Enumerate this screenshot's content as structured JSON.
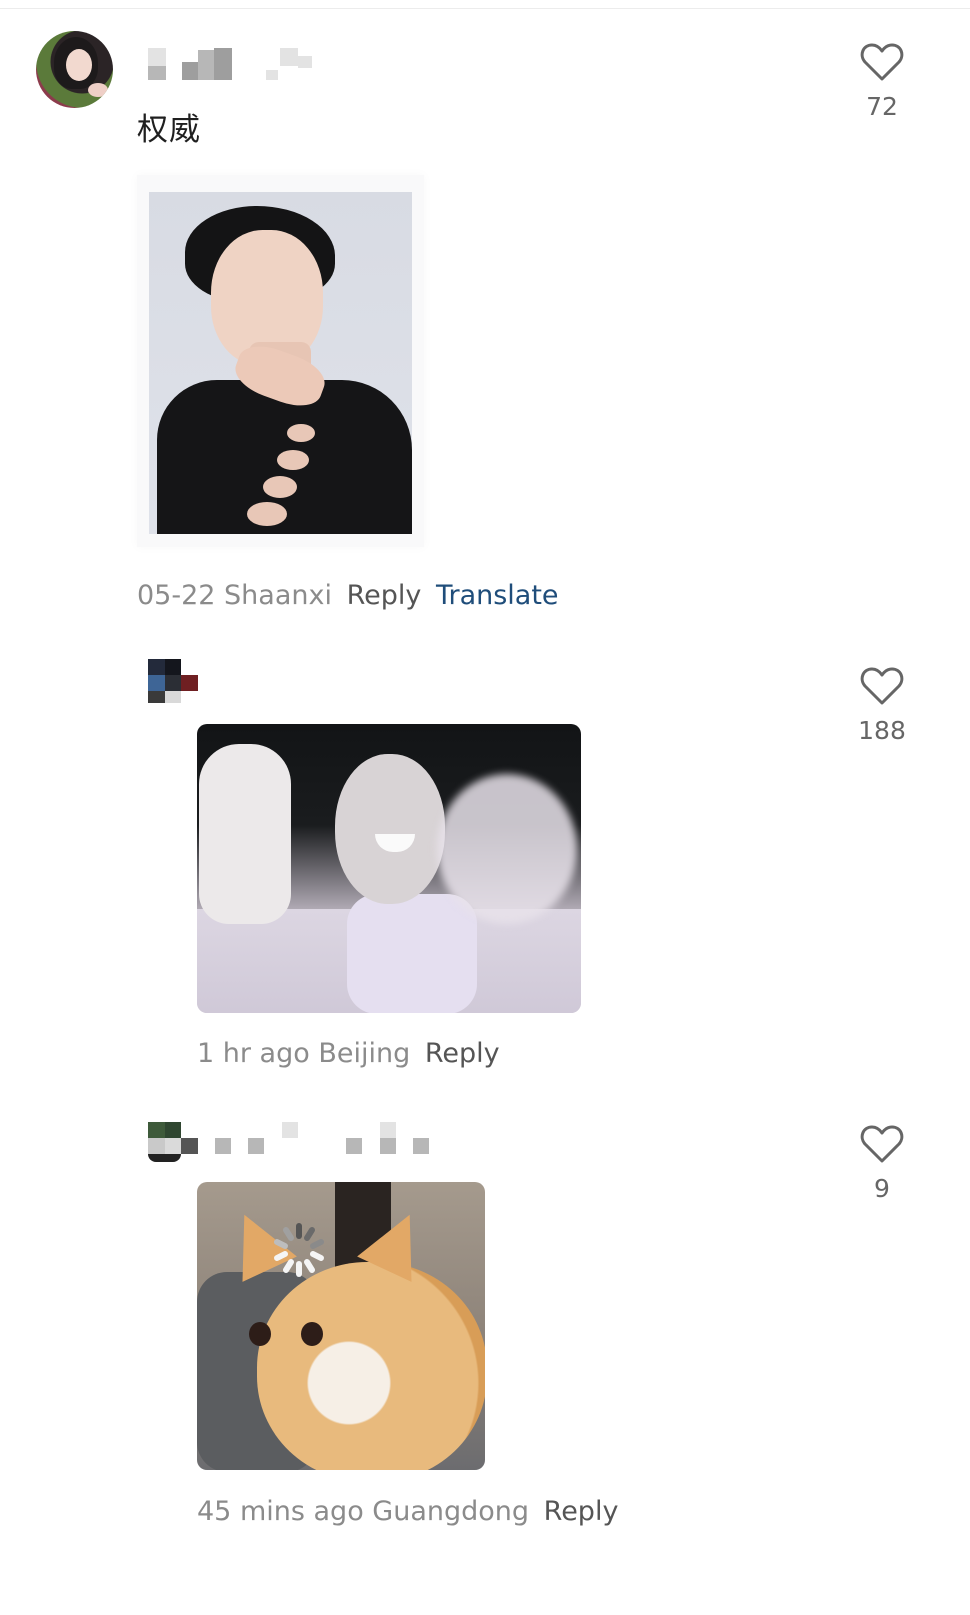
{
  "comments": [
    {
      "text": "权威",
      "date": "05-22",
      "location": "Shaanxi",
      "reply_label": "Reply",
      "translate_label": "Translate",
      "likes": "72"
    },
    {
      "date": "1 hr ago",
      "location": "Beijing",
      "reply_label": "Reply",
      "likes": "188"
    },
    {
      "date": "45 mins ago",
      "location": "Guangdong",
      "reply_label": "Reply",
      "likes": "9"
    }
  ],
  "icons": {
    "like": "heart-outline-icon",
    "loading": "loading-spinner-icon"
  },
  "colors": {
    "text_primary": "#1f1f1f",
    "text_meta": "#8b8b8b",
    "reply": "#555555",
    "translate": "#1f4d7a",
    "icon": "#666666"
  }
}
